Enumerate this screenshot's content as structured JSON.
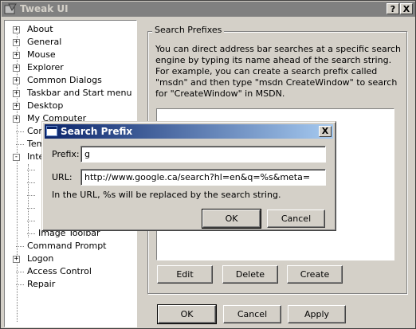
{
  "window": {
    "title": "Tweak UI",
    "help_button": "?",
    "close_button": "X"
  },
  "tree": {
    "items": [
      {
        "label": "About",
        "expander": "+"
      },
      {
        "label": "General",
        "expander": "+"
      },
      {
        "label": "Mouse",
        "expander": "+"
      },
      {
        "label": "Explorer",
        "expander": "+"
      },
      {
        "label": "Common Dialogs",
        "expander": "+"
      },
      {
        "label": "Taskbar and Start menu",
        "expander": "+"
      },
      {
        "label": "Desktop",
        "expander": "+"
      },
      {
        "label": "My Computer",
        "expander": "+"
      },
      {
        "label": "Con",
        "expander": ""
      },
      {
        "label": "Tem",
        "expander": ""
      },
      {
        "label": "Inte",
        "expander": "-"
      },
      {
        "label": "Image Toolbar",
        "expander": ""
      },
      {
        "label": "Command Prompt",
        "expander": ""
      },
      {
        "label": "Logon",
        "expander": "+"
      },
      {
        "label": "Access Control",
        "expander": ""
      },
      {
        "label": "Repair",
        "expander": ""
      }
    ]
  },
  "panel": {
    "group_title": "Search Prefixes",
    "description": "You can direct address bar searches at a specific search engine by typing its name ahead of the search string. For example, you can create a search prefix called \"msdn\" and then type \"msdn CreateWindow\" to search for \"CreateWindow\" in MSDN.",
    "edit_label": "Edit",
    "delete_label": "Delete",
    "create_label": "Create"
  },
  "footer": {
    "ok_label": "OK",
    "cancel_label": "Cancel",
    "apply_label": "Apply"
  },
  "dialog": {
    "title": "Search Prefix",
    "close_button": "X",
    "prefix_label": "Prefix:",
    "prefix_value": "g",
    "url_label": "URL:",
    "url_value": "http://www.google.ca/search?hl=en&q=%s&meta=",
    "hint": "In the URL, %s will be replaced by the search string.",
    "ok_label": "OK",
    "cancel_label": "Cancel"
  }
}
